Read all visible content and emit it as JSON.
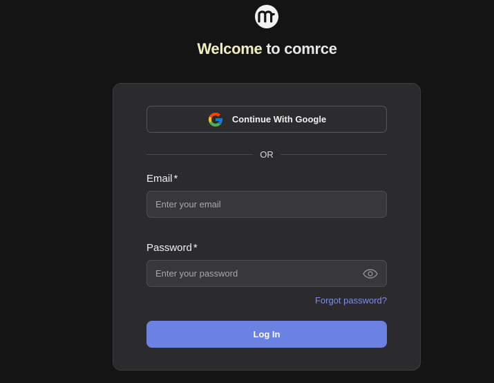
{
  "brand": {
    "logo_icon": "comrce-logo-icon",
    "welcome_prefix": "Welcome",
    "welcome_suffix": " to comrce"
  },
  "login_form": {
    "google_button_label": "Continue With Google",
    "google_icon": "google-icon",
    "divider_text": "OR",
    "email": {
      "label": "Email",
      "required_marker": "*",
      "placeholder": "Enter your email",
      "value": ""
    },
    "password": {
      "label": "Password",
      "required_marker": "*",
      "placeholder": "Enter your password",
      "value": "",
      "toggle_icon": "eye-icon"
    },
    "forgot_password_link": "Forgot password?",
    "submit_label": "Log In"
  },
  "colors": {
    "page_background": "#141414",
    "card_background": "#2b2b2d",
    "primary_button": "#6b82e2",
    "link": "#7b8ee8",
    "welcome_highlight": "#f3eec0"
  }
}
